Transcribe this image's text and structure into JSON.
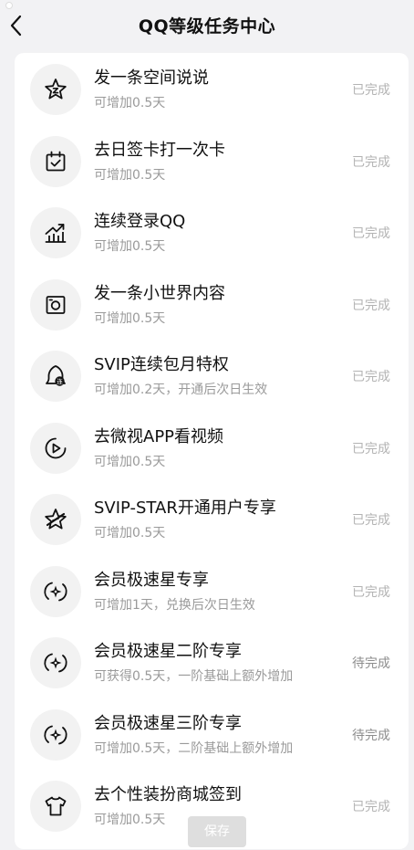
{
  "header": {
    "title": "QQ等级任务中心",
    "back_icon": "chevron-left-icon"
  },
  "tasks": [
    {
      "title": "发一条空间说说",
      "subtitle": "可增加0.5天",
      "status": "已完成",
      "icon": "star-z-icon"
    },
    {
      "title": "去日签卡打一次卡",
      "subtitle": "可增加0.5天",
      "status": "已完成",
      "icon": "calendar-check-icon"
    },
    {
      "title": "连续登录QQ",
      "subtitle": "可增加0.5天",
      "status": "已完成",
      "icon": "trend-chart-icon"
    },
    {
      "title": "发一条小世界内容",
      "subtitle": "可增加0.5天",
      "status": "已完成",
      "icon": "camera-square-icon"
    },
    {
      "title": "SVIP连续包月特权",
      "subtitle": "可增加0.2天，开通后次日生效",
      "status": "已完成",
      "icon": "svip-bell-icon"
    },
    {
      "title": "去微视APP看视频",
      "subtitle": "可增加0.5天",
      "status": "已完成",
      "icon": "play-circle-icon"
    },
    {
      "title": "SVIP-STAR开通用户专享",
      "subtitle": "可增加0.5天",
      "status": "已完成",
      "icon": "star-badge-icon"
    },
    {
      "title": "会员极速星专享",
      "subtitle": "可增加1天，兑换后次日生效",
      "status": "已完成",
      "icon": "compass-icon"
    },
    {
      "title": "会员极速星二阶专享",
      "subtitle": "可获得0.5天，一阶基础上额外增加",
      "status": "待完成",
      "icon": "compass-icon"
    },
    {
      "title": "会员极速星三阶专享",
      "subtitle": "可增加0.5天，二阶基础上额外增加",
      "status": "待完成",
      "icon": "compass-icon"
    },
    {
      "title": "去个性装扮商城签到",
      "subtitle": "可增加0.5天",
      "status": "已完成",
      "icon": "tshirt-icon"
    }
  ],
  "save_label": "保存"
}
